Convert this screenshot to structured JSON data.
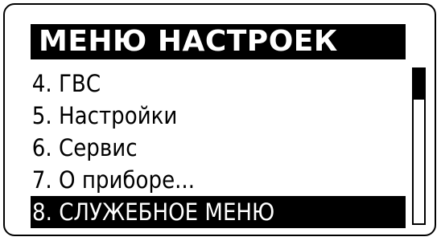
{
  "title": "МЕНЮ НАСТРОЕК",
  "menu": {
    "items": [
      {
        "label": "4. ГВС",
        "selected": false
      },
      {
        "label": "5. Настройки",
        "selected": false
      },
      {
        "label": "6. Сервис",
        "selected": false
      },
      {
        "label": "7. О приборе...",
        "selected": false
      },
      {
        "label": "8. СЛУЖЕБНОЕ МЕНЮ",
        "selected": true
      }
    ]
  },
  "scrollbar": {
    "position_fraction": 0.0,
    "thumb_fraction": 0.2
  },
  "colors": {
    "background": "#ffffff",
    "foreground": "#000000",
    "highlight": "#000000",
    "highlight_text": "#ffffff"
  }
}
